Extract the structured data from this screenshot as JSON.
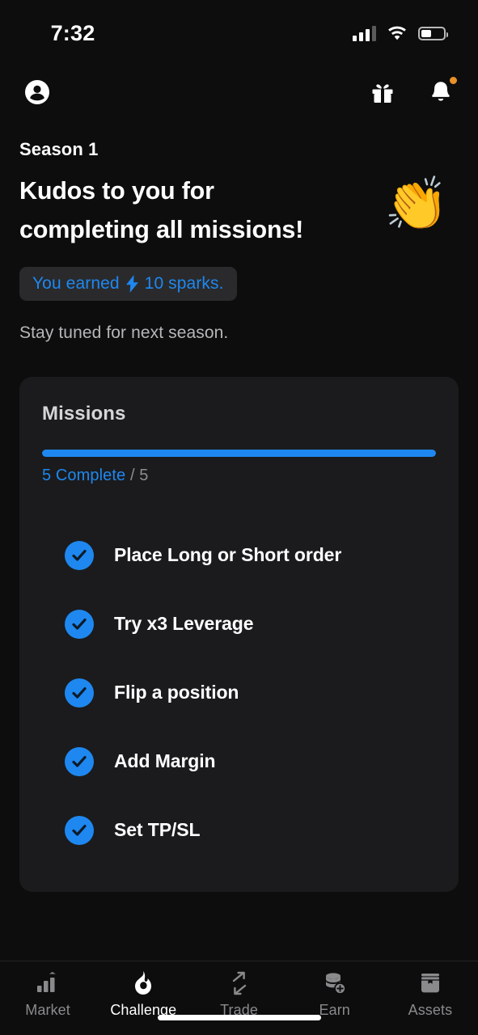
{
  "status_bar": {
    "time": "7:32",
    "signal_icon": "signal-bars-icon",
    "wifi_icon": "wifi-icon",
    "battery_icon": "battery-icon",
    "battery_level_percent": 45
  },
  "header": {
    "avatar_icon": "account-circle-icon",
    "gift_icon": "gift-icon",
    "bell_icon": "bell-icon",
    "bell_has_badge": true,
    "badge_color": "#e8912a"
  },
  "hero": {
    "season": "Season 1",
    "headline_line1": "Kudos to you for",
    "headline_line2": "completing all missions!",
    "emoji": "👏",
    "emoji_name": "clapping-hands-emoji",
    "badge_prefix": "You earned",
    "badge_icon": "lightning-bolt-icon",
    "badge_value": "10 sparks.",
    "subnote": "Stay tuned for next season."
  },
  "missions_card": {
    "title": "Missions",
    "progress_percent": 100,
    "progress_done_label": "5 Complete",
    "progress_total_label": "/ 5",
    "items": [
      {
        "label": "Place Long or Short order",
        "completed": true,
        "icon": "check-icon"
      },
      {
        "label": "Try x3 Leverage",
        "completed": true,
        "icon": "check-icon"
      },
      {
        "label": "Flip a position",
        "completed": true,
        "icon": "check-icon"
      },
      {
        "label": "Add Margin",
        "completed": true,
        "icon": "check-icon"
      },
      {
        "label": "Set TP/SL",
        "completed": true,
        "icon": "check-icon"
      }
    ]
  },
  "tabbar": {
    "items": [
      {
        "label": "Market",
        "icon": "bar-chart-arrow-icon",
        "active": false
      },
      {
        "label": "Challenge",
        "icon": "flame-icon",
        "active": true
      },
      {
        "label": "Trade",
        "icon": "exchange-arrows-icon",
        "active": false
      },
      {
        "label": "Earn",
        "icon": "coin-stack-plus-icon",
        "active": false
      },
      {
        "label": "Assets",
        "icon": "chest-box-icon",
        "active": false
      }
    ]
  },
  "colors": {
    "accent_blue": "#1e88f0",
    "page_bg": "#0d0d0d",
    "card_bg": "#1b1b1d",
    "badge_bg": "#2a2a2c",
    "muted_text": "#8a8a8d"
  }
}
